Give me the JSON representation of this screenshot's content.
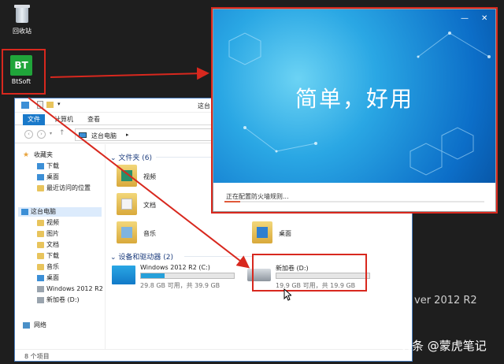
{
  "desktop": {
    "recycle_bin_label": "回收站",
    "app_icon_text": "BT",
    "app_label": "BtSoft",
    "bg_text": "ver 2012 R2",
    "watermark": "头条 @蒙虎笔记"
  },
  "explorer": {
    "title": "这台",
    "ribbon_tabs": [
      "文件",
      "计算机",
      "查看"
    ],
    "address": "这台电脑",
    "nav": {
      "favorites_header": "收藏夹",
      "favorites": [
        "下载",
        "桌面",
        "最近访问的位置"
      ],
      "pc_header": "这台电脑",
      "pc_items": [
        "视频",
        "图片",
        "文档",
        "下载",
        "音乐",
        "桌面",
        "Windows 2012 R2",
        "新加卷 (D:)"
      ],
      "network": "网络"
    },
    "folders_header": "文件夹 (6)",
    "folders": [
      "视频",
      "文档",
      "音乐",
      "桌面"
    ],
    "drives_header": "设备和驱动器 (2)",
    "drives": [
      {
        "name": "Windows 2012 R2 (C:)",
        "capacity": "29.8 GB 可用，共 39.9 GB",
        "used_fraction": 0.25
      },
      {
        "name": "新加卷 (D:)",
        "capacity": "19.9 GB 可用，共 19.9 GB",
        "used_fraction": 0.0
      }
    ],
    "status": "8 个项目"
  },
  "installer": {
    "slogan": "简单，好用",
    "status": "正在配置防火墙规则...",
    "progress": 0.06,
    "accent_color": "#e05a3a"
  },
  "colors": {
    "annotation_red": "#d8281e",
    "bt_green": "#20a53a",
    "file_tab_blue": "#1979ca"
  }
}
